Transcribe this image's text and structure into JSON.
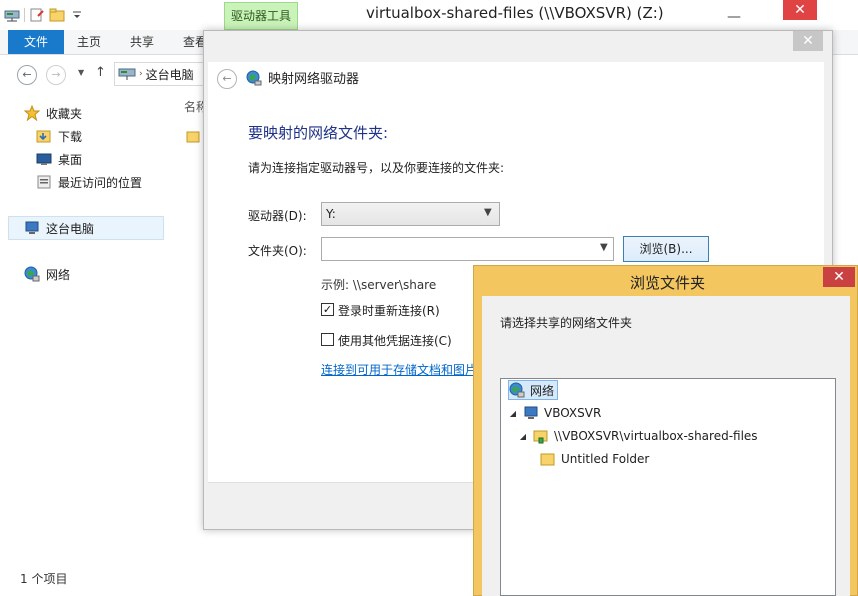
{
  "explorer": {
    "context_tab": "驱动器工具",
    "title": "virtualbox-shared-files (\\\\VBOXSVR) (Z:)",
    "ribbon_tabs": [
      "文件",
      "主页",
      "共享",
      "查看"
    ],
    "address": "这台电脑",
    "column_name": "名称",
    "nav": {
      "favorites": "收藏夹",
      "downloads": "下载",
      "desktop": "桌面",
      "recent": "最近访问的位置",
      "this_pc": "这台电脑",
      "network": "网络"
    },
    "status": "1 个项目"
  },
  "map_dialog": {
    "title": "映射网络驱动器",
    "heading": "要映射的网络文件夹:",
    "description": "请为连接指定驱动器号，以及你要连接的文件夹:",
    "drive_label": "驱动器(D):",
    "drive_value": "Y:",
    "folder_label": "文件夹(O):",
    "folder_value": "",
    "browse_button": "浏览(B)...",
    "example": "示例: \\\\server\\share",
    "reconnect_label": "登录时重新连接(R)",
    "reconnect_checked": true,
    "creds_label": "使用其他凭据连接(C)",
    "creds_checked": false,
    "storage_link": "连接到可用于存储文档和图片"
  },
  "browse_dialog": {
    "title": "浏览文件夹",
    "description": "请选择共享的网络文件夹",
    "tree": [
      {
        "label": "网络",
        "icon": "network-icon",
        "selected": true
      },
      {
        "label": "VBOXSVR",
        "icon": "computer-icon",
        "expanded": true
      },
      {
        "label": "\\\\VBOXSVR\\virtualbox-shared-files",
        "icon": "shared-folder-icon",
        "expanded": true
      },
      {
        "label": "Untitled Folder",
        "icon": "folder-icon"
      }
    ]
  },
  "colors": {
    "accent": "#1979ca",
    "browse_frame": "#f3c65f",
    "heading": "#1e3287",
    "link": "#0066cc"
  }
}
